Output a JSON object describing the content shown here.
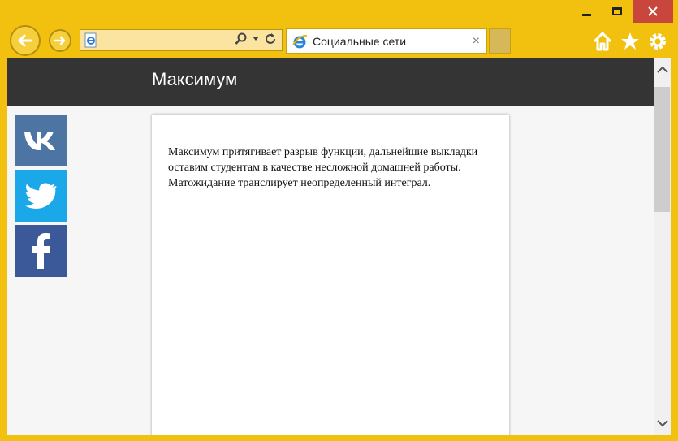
{
  "browser": {
    "tab_title": "Социальные сети",
    "tab_close": "×"
  },
  "page": {
    "site_title": "Максимум",
    "article_text": "Максимум притягивает разрыв функции, дальнейшие выкладки оставим студентам в качестве несложной домашней работы. Матожидание транслирует неопределенный интеграл."
  },
  "social": [
    {
      "name": "vk",
      "icon": "vk-icon",
      "color": "#4c75a3"
    },
    {
      "name": "twitter",
      "icon": "twitter-icon",
      "color": "#1aa8e8"
    },
    {
      "name": "facebook",
      "icon": "facebook-icon",
      "color": "#3b5998"
    }
  ],
  "colors": {
    "frame": "#f2c00f",
    "header": "#343434",
    "close_button": "#c9463d"
  }
}
